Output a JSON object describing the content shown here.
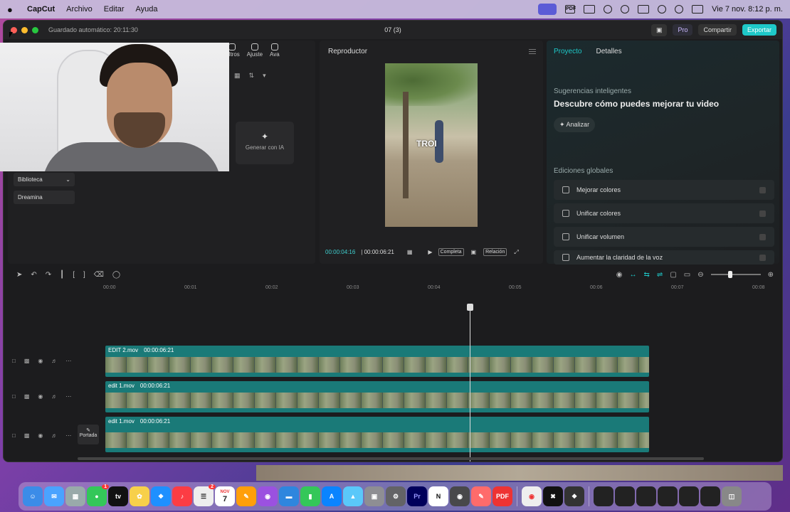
{
  "menubar": {
    "app": "CapCut",
    "items": [
      "Archivo",
      "Editar",
      "Ayuda"
    ],
    "clock": "Vie 7 nov.  8:12 p. m."
  },
  "window": {
    "autosave": "Guardado automático: 20:11:30",
    "title": "07 (3)",
    "pro": "Pro",
    "share": "Compartir",
    "export": "Exportar"
  },
  "left_panel": {
    "tabs": [
      "Filtros",
      "Ajuste",
      "Ava"
    ],
    "ai_card": "Generar con IA",
    "side": [
      "Biblioteca",
      "Dreamina"
    ]
  },
  "player": {
    "title": "Reproductor",
    "overlay_text": "TROI",
    "current": "00:00:04:16",
    "duration": "00:00:06:21",
    "full": "Completa",
    "ratio": "Relación"
  },
  "right_panel": {
    "tabs": [
      "Proyecto",
      "Detalles"
    ],
    "smart_title": "Sugerencias inteligentes",
    "smart_heading": "Descubre cómo puedes mejorar tu video",
    "analyze": "Analizar",
    "global_title": "Ediciones globales",
    "global_items": [
      "Mejorar colores",
      "Unificar colores",
      "Unificar volumen",
      "Aumentar la claridad de la voz"
    ]
  },
  "timeline": {
    "ruler": [
      "00:00",
      "00:01",
      "00:02",
      "00:03",
      "00:04",
      "00:05",
      "00:06",
      "00:07",
      "00:08"
    ],
    "clips": [
      {
        "name": "EDIT 2.mov",
        "dur": "00:00:06:21"
      },
      {
        "name": "edit 1.mov",
        "dur": "00:00:06:21"
      },
      {
        "name": "edit 1.mov",
        "dur": "00:00:06:21"
      }
    ],
    "cover": "Portada"
  },
  "dock": {
    "calendar_month": "NOV",
    "calendar_day": "7",
    "badge_messages": "1",
    "badge_reminders": "2"
  }
}
